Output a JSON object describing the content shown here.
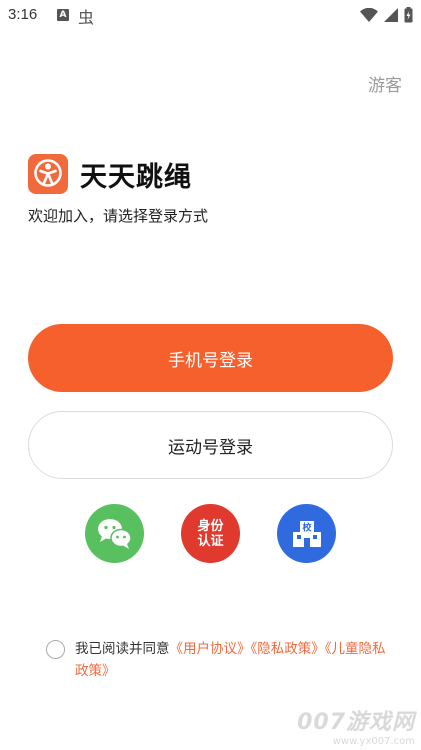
{
  "status_bar": {
    "time": "3:16",
    "a_label": "A",
    "bug_glyph": "虫"
  },
  "guest_label": "游客",
  "brand": {
    "name": "天天跳绳",
    "welcome": "欢迎加入，请选择登录方式",
    "logo_color": "#f26a3c"
  },
  "buttons": {
    "phone_login": "手机号登录",
    "sport_login": "运动号登录",
    "accent": "#f6602c"
  },
  "third_party": {
    "wechat": {
      "icon": "wechat-icon",
      "color": "#58c05f"
    },
    "identity": {
      "line1": "身份",
      "line2": "认证",
      "color": "#e0392e"
    },
    "school": {
      "icon": "school-icon",
      "badge": "校",
      "color": "#2f6bde"
    }
  },
  "agreement": {
    "prefix": "我已阅读并同意",
    "user_agreement": "《用户协议》",
    "privacy_policy": "《隐私政策》",
    "child_privacy": "《儿童隐私政策》"
  },
  "watermark": {
    "main": "007游戏网",
    "url": "www.yx007.com"
  }
}
